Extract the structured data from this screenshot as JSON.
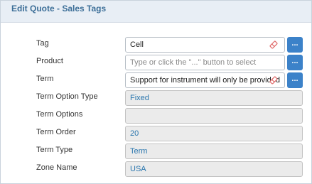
{
  "header": {
    "title": "Edit Quote - Sales Tags"
  },
  "fields": [
    {
      "label": "Tag",
      "value": "Cell",
      "type": "lookup"
    },
    {
      "label": "Product",
      "placeholder": "Type or click the \"...\" button to select",
      "type": "lookup"
    },
    {
      "label": "Term",
      "value": "Support for instrument will only be provided",
      "type": "lookup"
    },
    {
      "label": "Term Option Type",
      "value": "Fixed",
      "type": "readonly"
    },
    {
      "label": "Term Options",
      "value": "",
      "type": "readonly"
    },
    {
      "label": "Term Order",
      "value": "20",
      "type": "readonly"
    },
    {
      "label": "Term Type",
      "value": "Term",
      "type": "readonly"
    },
    {
      "label": "Zone Name",
      "value": "USA",
      "type": "readonly"
    }
  ],
  "buttons": {
    "lookup_label": "..."
  },
  "icons": {
    "clear": "eraser-icon"
  }
}
